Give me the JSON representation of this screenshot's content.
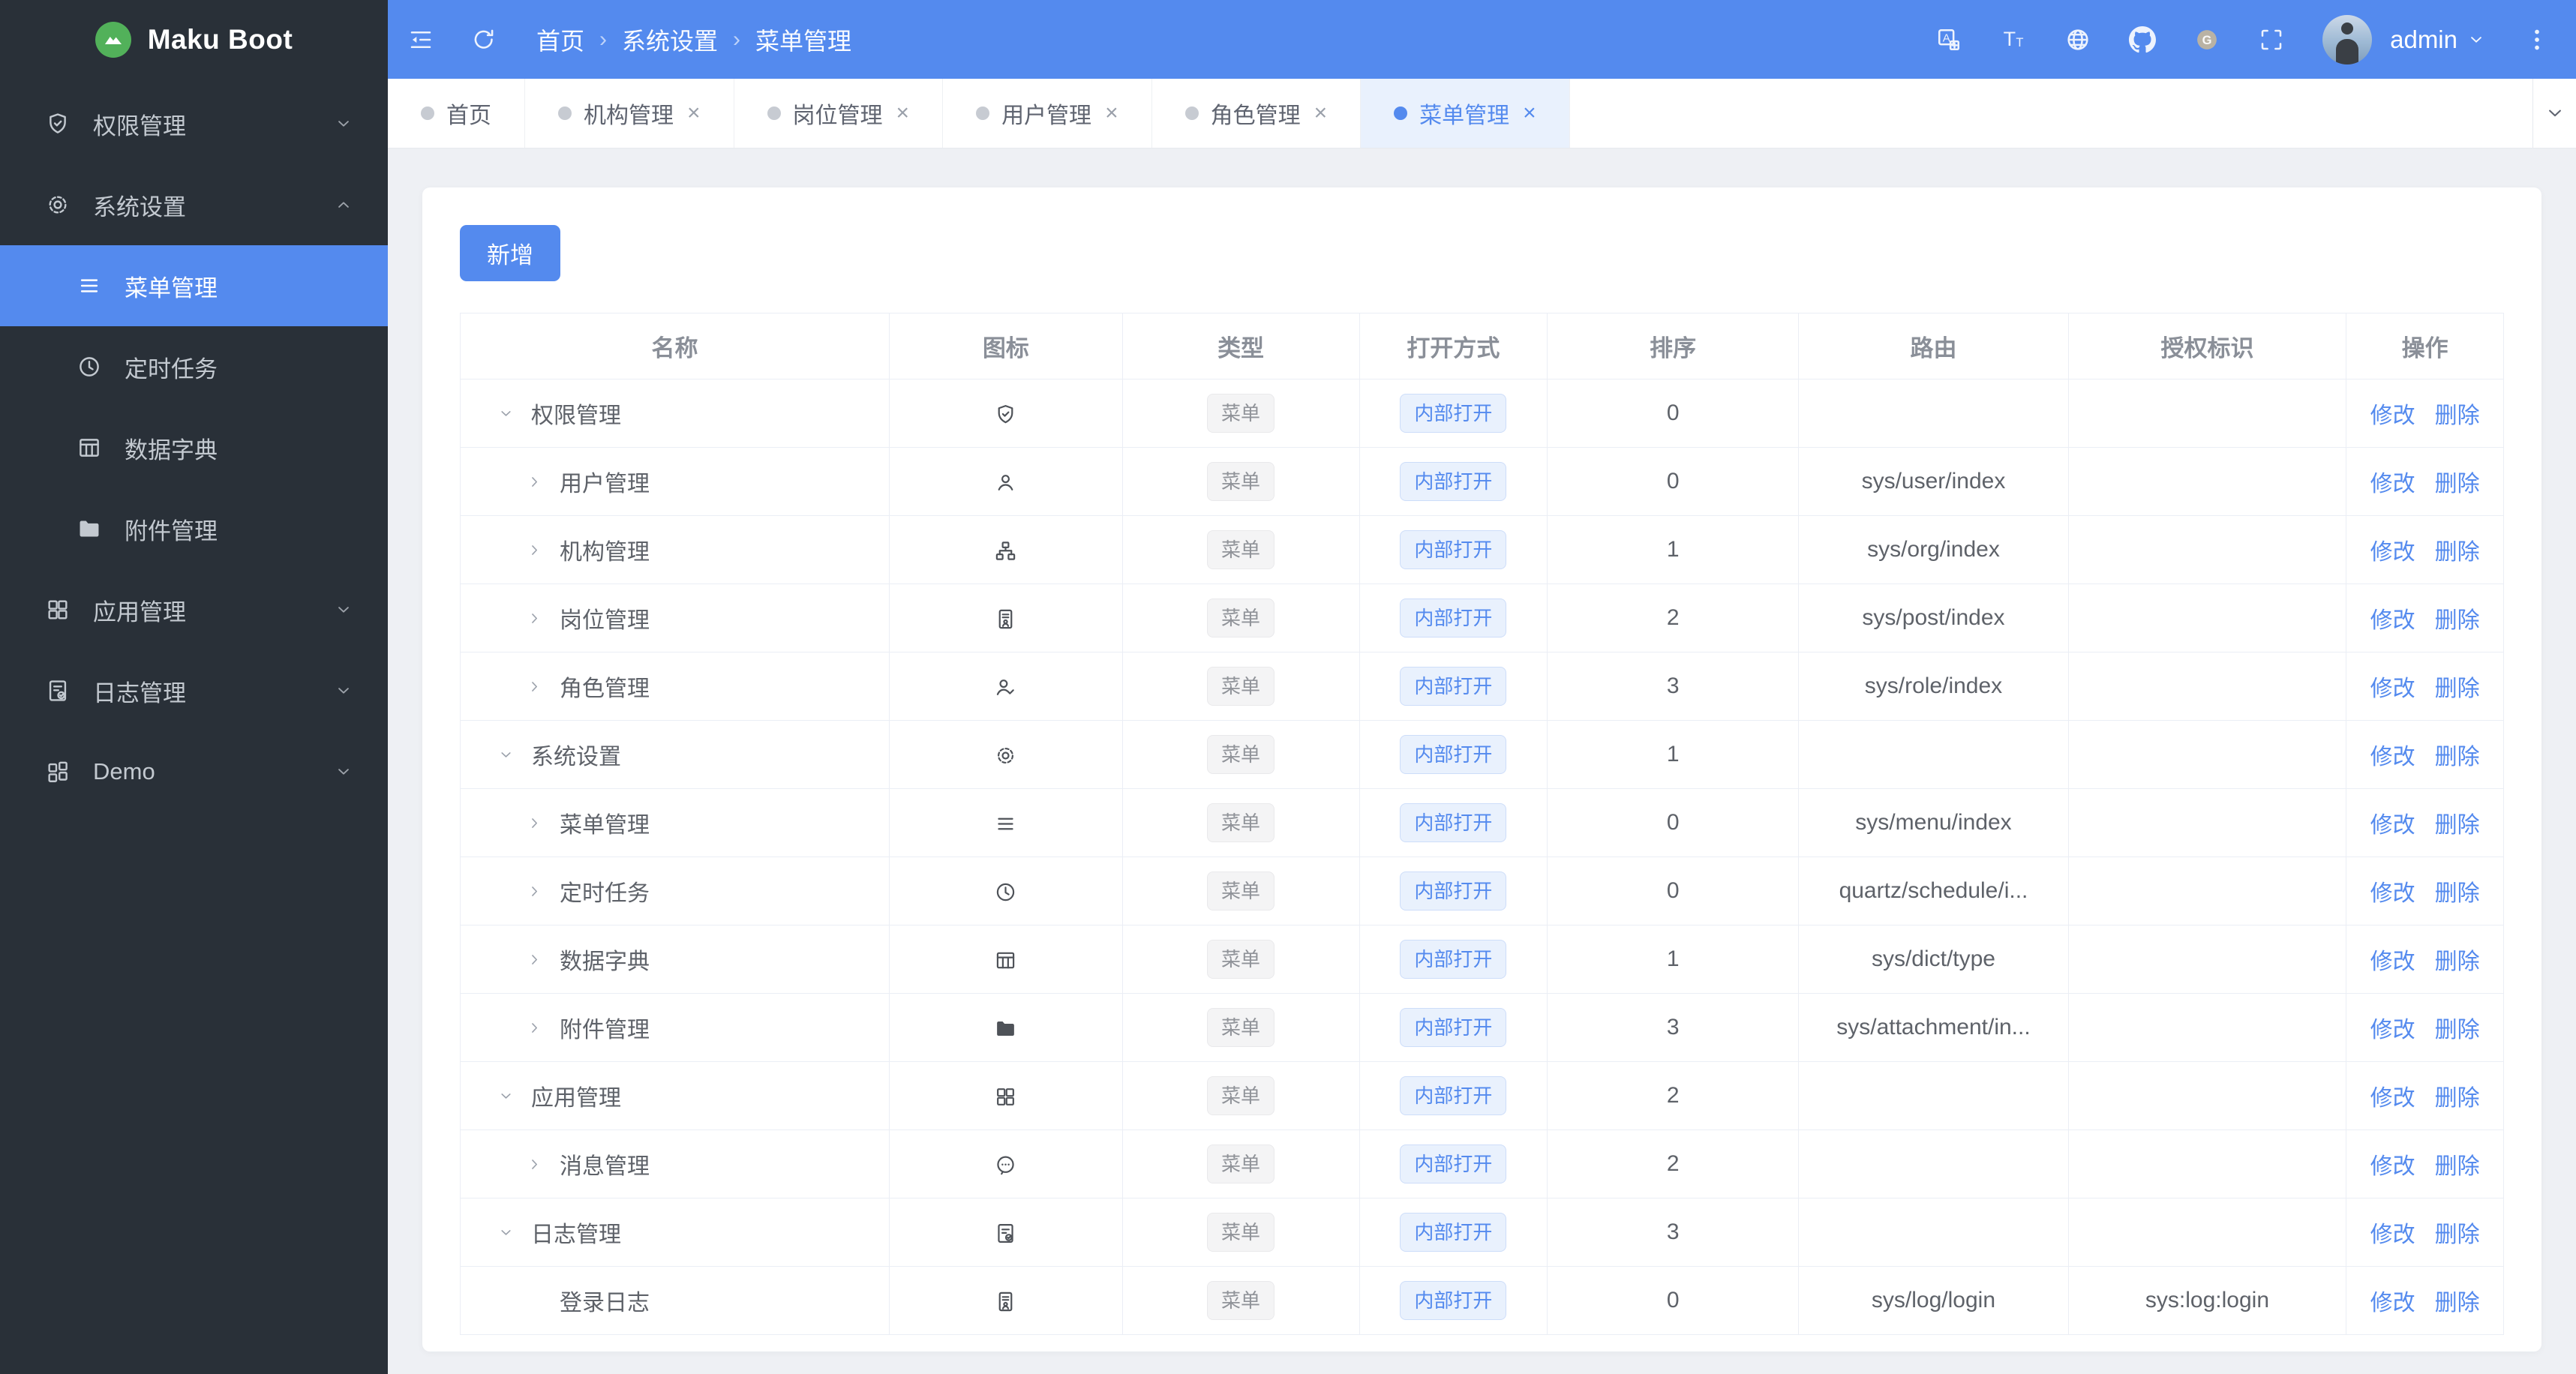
{
  "colors": {
    "accent": "#548aee",
    "sidebar_bg": "#293038",
    "content_bg": "#eef0f4",
    "active_tab_bg": "#e9f1fd",
    "tag_type_bg": "#f4f4f5",
    "tag_open_bg": "#e9f1fd",
    "logo_green": "#52b15a"
  },
  "app": {
    "title": "Maku Boot"
  },
  "topbar": {
    "icons_left": [
      "collapse",
      "refresh"
    ],
    "breadcrumb": [
      "首页",
      "系统设置",
      "菜单管理"
    ],
    "icons_right": [
      "translate",
      "font-size",
      "globe",
      "github",
      "gitee",
      "fullscreen"
    ],
    "user": {
      "name": "admin"
    }
  },
  "sidebar": {
    "items": [
      {
        "id": "perms",
        "label": "权限管理",
        "icon": "shield-check",
        "chevron": "down"
      },
      {
        "id": "system",
        "label": "系统设置",
        "icon": "gear",
        "chevron": "up",
        "expanded": true,
        "children": [
          {
            "id": "menu",
            "label": "菜单管理",
            "icon": "menu-lines",
            "active": true
          },
          {
            "id": "schedule",
            "label": "定时任务",
            "icon": "clock"
          },
          {
            "id": "dict",
            "label": "数据字典",
            "icon": "dict-table"
          },
          {
            "id": "attachment",
            "label": "附件管理",
            "icon": "folder"
          }
        ]
      },
      {
        "id": "apps",
        "label": "应用管理",
        "icon": "app-grid",
        "chevron": "down"
      },
      {
        "id": "logs",
        "label": "日志管理",
        "icon": "log-doc",
        "chevron": "down"
      },
      {
        "id": "demo",
        "label": "Demo",
        "icon": "demo-grid",
        "chevron": "down"
      }
    ]
  },
  "tabs": [
    {
      "label": "首页",
      "closable": false,
      "active": false
    },
    {
      "label": "机构管理",
      "closable": true,
      "active": false
    },
    {
      "label": "岗位管理",
      "closable": true,
      "active": false
    },
    {
      "label": "用户管理",
      "closable": true,
      "active": false
    },
    {
      "label": "角色管理",
      "closable": true,
      "active": false
    },
    {
      "label": "菜单管理",
      "closable": true,
      "active": true
    }
  ],
  "toolbar": {
    "add_label": "新增"
  },
  "table": {
    "columns": [
      "名称",
      "图标",
      "类型",
      "打开方式",
      "排序",
      "路由",
      "授权标识",
      "操作"
    ],
    "column_widths": [
      "21%",
      "11.4%",
      "11.6%",
      "9.2%",
      "12.3%",
      "13.2%",
      "13.6%",
      "7.7%"
    ],
    "type_tag": "菜单",
    "open_tag": "内部打开",
    "actions": [
      "修改",
      "删除"
    ],
    "rows": [
      {
        "name": "权限管理",
        "level": 0,
        "arrow": "down",
        "icon": "shield-check",
        "sort": "0",
        "route": "",
        "perm": ""
      },
      {
        "name": "用户管理",
        "level": 1,
        "arrow": "right",
        "icon": "user",
        "sort": "0",
        "route": "sys/user/index",
        "perm": ""
      },
      {
        "name": "机构管理",
        "level": 1,
        "arrow": "right",
        "icon": "org",
        "sort": "1",
        "route": "sys/org/index",
        "perm": ""
      },
      {
        "name": "岗位管理",
        "level": 1,
        "arrow": "right",
        "icon": "badge",
        "sort": "2",
        "route": "sys/post/index",
        "perm": ""
      },
      {
        "name": "角色管理",
        "level": 1,
        "arrow": "right",
        "icon": "user-check",
        "sort": "3",
        "route": "sys/role/index",
        "perm": ""
      },
      {
        "name": "系统设置",
        "level": 0,
        "arrow": "down",
        "icon": "gear",
        "sort": "1",
        "route": "",
        "perm": ""
      },
      {
        "name": "菜单管理",
        "level": 1,
        "arrow": "right",
        "icon": "menu-lines",
        "sort": "0",
        "route": "sys/menu/index",
        "perm": ""
      },
      {
        "name": "定时任务",
        "level": 1,
        "arrow": "right",
        "icon": "clock",
        "sort": "0",
        "route": "quartz/schedule/i...",
        "perm": ""
      },
      {
        "name": "数据字典",
        "level": 1,
        "arrow": "right",
        "icon": "dict-table",
        "sort": "1",
        "route": "sys/dict/type",
        "perm": ""
      },
      {
        "name": "附件管理",
        "level": 1,
        "arrow": "right",
        "icon": "folder",
        "sort": "3",
        "route": "sys/attachment/in...",
        "perm": ""
      },
      {
        "name": "应用管理",
        "level": 0,
        "arrow": "down",
        "icon": "app-grid",
        "sort": "2",
        "route": "",
        "perm": ""
      },
      {
        "name": "消息管理",
        "level": 1,
        "arrow": "right",
        "icon": "message",
        "sort": "2",
        "route": "",
        "perm": ""
      },
      {
        "name": "日志管理",
        "level": 0,
        "arrow": "down",
        "icon": "log-doc",
        "sort": "3",
        "route": "",
        "perm": ""
      },
      {
        "name": "登录日志",
        "level": 1,
        "arrow": "none",
        "icon": "badge",
        "sort": "0",
        "route": "sys/log/login",
        "perm": "sys:log:login"
      }
    ]
  }
}
